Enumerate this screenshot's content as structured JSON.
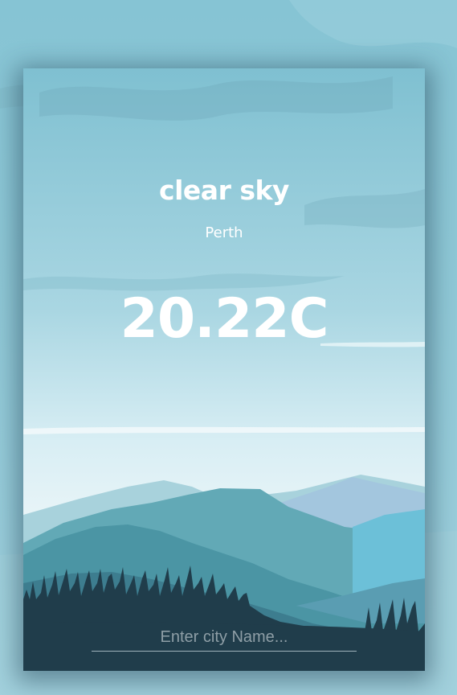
{
  "weather": {
    "condition": "clear sky",
    "city": "Perth",
    "temperature": "20.22C"
  },
  "search": {
    "placeholder": "Enter city Name...",
    "value": ""
  },
  "colors": {
    "text": "#ffffff",
    "sky_top": "#7fc0d1",
    "sky_bottom": "#eaf5f8",
    "trees": "#1f3c4a",
    "input_underline": "#9fb3bb"
  }
}
